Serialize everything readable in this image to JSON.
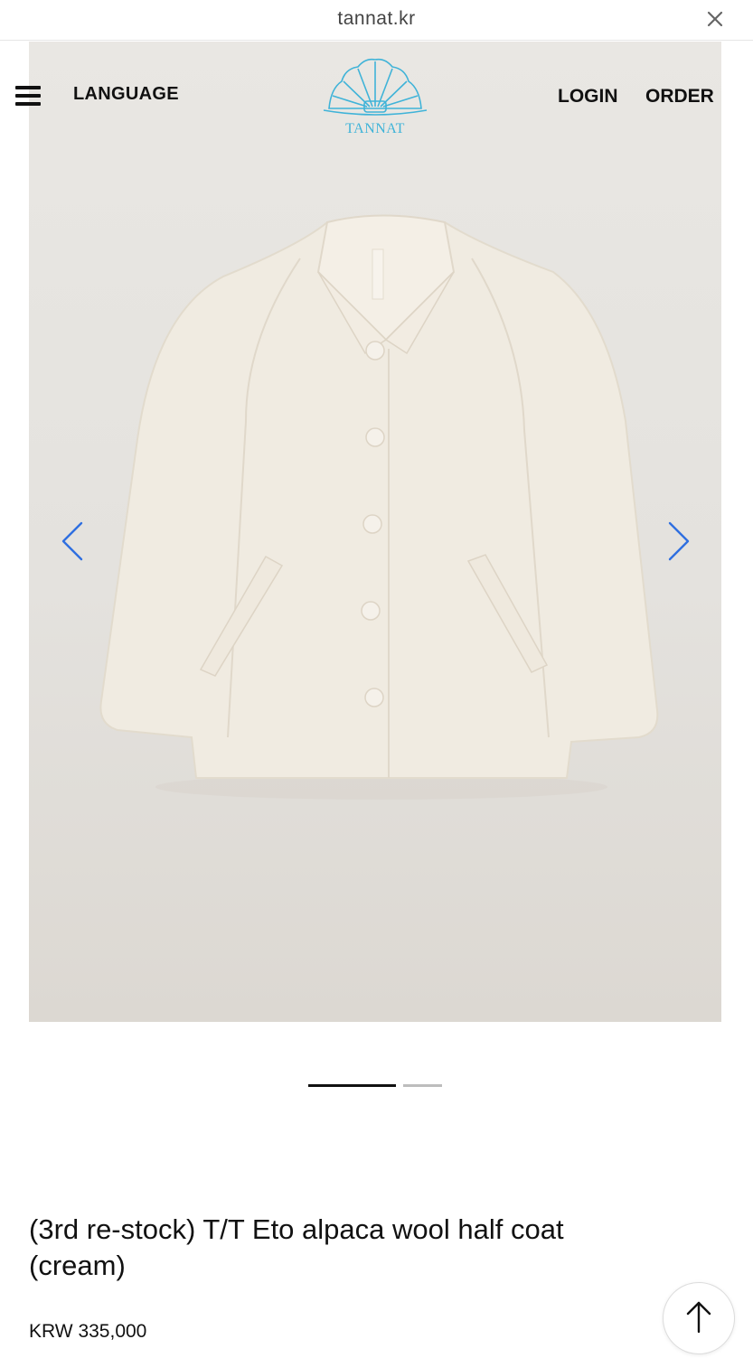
{
  "browser": {
    "url": "tannat.kr"
  },
  "nav": {
    "language": "LANGUAGE",
    "login": "LOGIN",
    "order": "ORDER",
    "logo_text": "TANNAT"
  },
  "gallery": {
    "current": 1,
    "total": 2
  },
  "product": {
    "name": "(3rd re-stock) T/T Eto alpaca wool half coat (cream)",
    "price": "KRW 335,000"
  },
  "icons": {
    "menu": "hamburger-menu-icon",
    "close": "close-icon",
    "prev": "chevron-left-icon",
    "next": "chevron-right-icon",
    "top": "arrow-up-icon",
    "logo": "shell-logo-icon"
  },
  "colors": {
    "accent": "#2f6fe0",
    "logo": "#3fb3d8",
    "coat": "#f0ebe1"
  }
}
